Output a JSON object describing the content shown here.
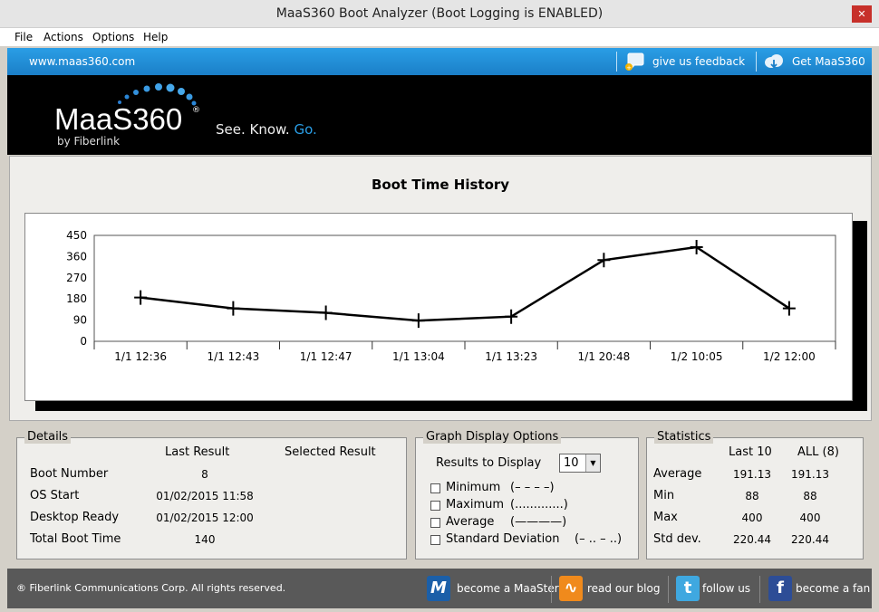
{
  "window": {
    "title": "MaaS360 Boot Analyzer (Boot Logging is ENABLED)"
  },
  "menu": {
    "items": [
      "File",
      "Actions",
      "Options",
      "Help"
    ]
  },
  "topbar": {
    "url": "www.maas360.com",
    "feedback_label": "give us feedback",
    "get_label": "Get MaaS360"
  },
  "banner": {
    "logo": "MaaS360",
    "registered": "®",
    "byline": "by Fiberlink",
    "tagline_a": "See. Know.",
    "tagline_go": "Go."
  },
  "graph": {
    "title": "Boot Time History"
  },
  "chart_data": {
    "type": "line",
    "title": "Boot Time History",
    "categories": [
      "1/1 12:36",
      "1/1 12:43",
      "1/1 12:47",
      "1/1 13:04",
      "1/1 13:23",
      "1/1 20:48",
      "1/2 10:05",
      "1/2 12:00"
    ],
    "values": [
      186,
      140,
      121,
      88,
      105,
      345,
      400,
      140
    ],
    "yticks": [
      "450",
      "360",
      "270",
      "180",
      "90",
      "0"
    ],
    "ylim": [
      0,
      450
    ],
    "grid": false,
    "line_color": "#000000",
    "marker": "plus"
  },
  "details": {
    "legend": "Details",
    "col_last": "Last Result",
    "col_selected": "Selected Result",
    "rows": [
      {
        "label": "Boot Number",
        "last": "8",
        "selected": ""
      },
      {
        "label": "OS Start",
        "last": "01/02/2015 11:58",
        "selected": ""
      },
      {
        "label": "Desktop Ready",
        "last": "01/02/2015 12:00",
        "selected": ""
      },
      {
        "label": "Total Boot Time",
        "last": "140",
        "selected": ""
      }
    ]
  },
  "options": {
    "legend": "Graph Display Options",
    "results_label": "Results to Display",
    "results_value": "10",
    "checks": [
      {
        "label": "Minimum",
        "key": "(– – – –)",
        "checked": false
      },
      {
        "label": "Maximum",
        "key": "(.............)",
        "checked": false
      },
      {
        "label": "Average",
        "key": "(————)",
        "checked": false
      },
      {
        "label": "Standard Deviation",
        "key": "(– ..  – ..)",
        "checked": false
      }
    ]
  },
  "stats": {
    "legend": "Statistics",
    "col_last10": "Last 10",
    "col_all": "ALL (8)",
    "rows": [
      {
        "label": "Average",
        "last10": "191.13",
        "all": "191.13"
      },
      {
        "label": "Min",
        "last10": "88",
        "all": "88"
      },
      {
        "label": "Max",
        "last10": "400",
        "all": "400"
      },
      {
        "label": "Std dev.",
        "last10": "220.44",
        "all": "220.44"
      }
    ]
  },
  "footer": {
    "copyright": "® Fiberlink Communications Corp. All rights reserved.",
    "maaster": "become a MaaSter",
    "blog": "read our blog",
    "follow": "follow us",
    "fan": "become a fan"
  },
  "colors": {
    "accent_blue": "#1b7fc8",
    "banner_black": "#000000",
    "footer_gray": "#595959",
    "close_red": "#c7302a"
  }
}
